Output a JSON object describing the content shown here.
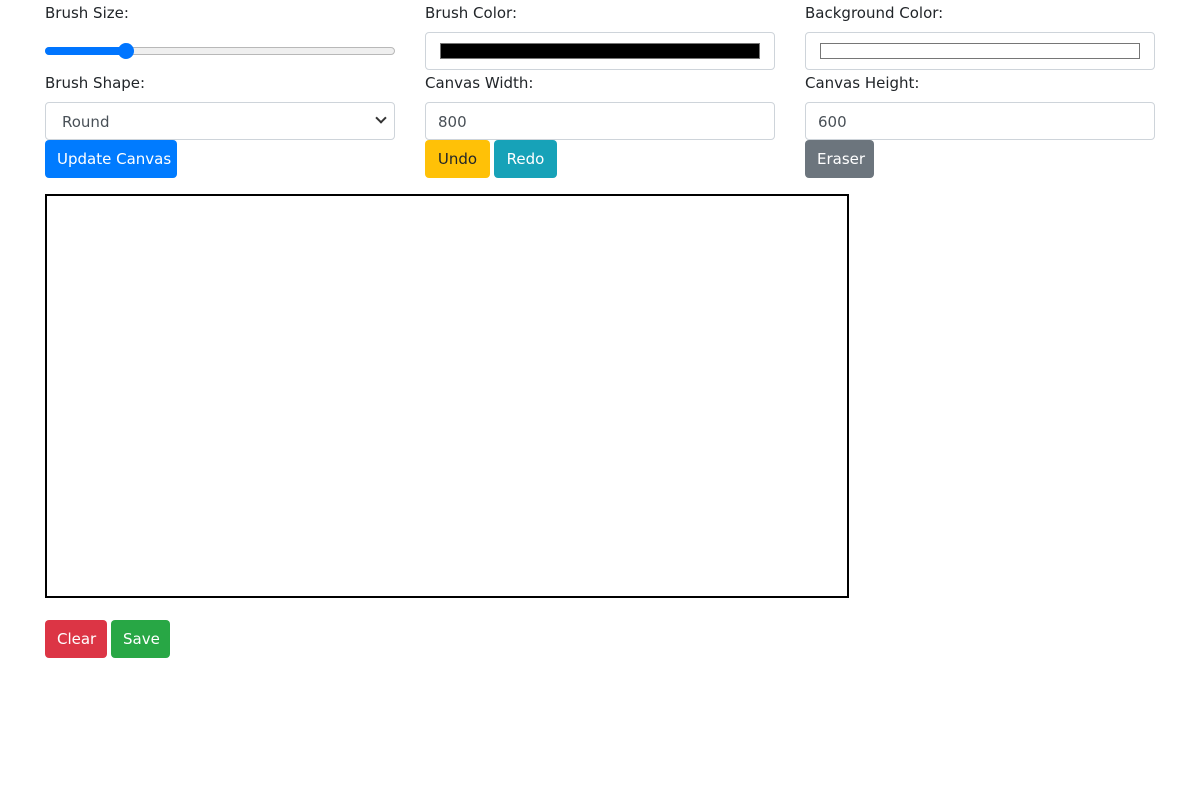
{
  "brush_size": {
    "label": "Brush Size:",
    "value_fraction": 0.22
  },
  "brush_color": {
    "label": "Brush Color:",
    "value": "#000000"
  },
  "background_color": {
    "label": "Background Color:",
    "value": "#ffffff"
  },
  "brush_shape": {
    "label": "Brush Shape:",
    "selected": "Round"
  },
  "canvas_width": {
    "label": "Canvas Width:",
    "value": "800"
  },
  "canvas_height": {
    "label": "Canvas Height:",
    "value": "600"
  },
  "buttons": {
    "update_canvas": {
      "label": "Update Canvas",
      "color": "#007bff",
      "text_color": "#ffffff"
    },
    "undo": {
      "label": "Undo",
      "color": "#ffc107",
      "text_color": "#212529"
    },
    "redo": {
      "label": "Redo",
      "color": "#17a2b8",
      "text_color": "#ffffff"
    },
    "eraser": {
      "label": "Eraser",
      "color": "#6c757d",
      "text_color": "#ffffff"
    },
    "clear": {
      "label": "Clear",
      "color": "#dc3545",
      "text_color": "#ffffff"
    },
    "save": {
      "label": "Save",
      "color": "#28a745",
      "text_color": "#ffffff"
    }
  }
}
